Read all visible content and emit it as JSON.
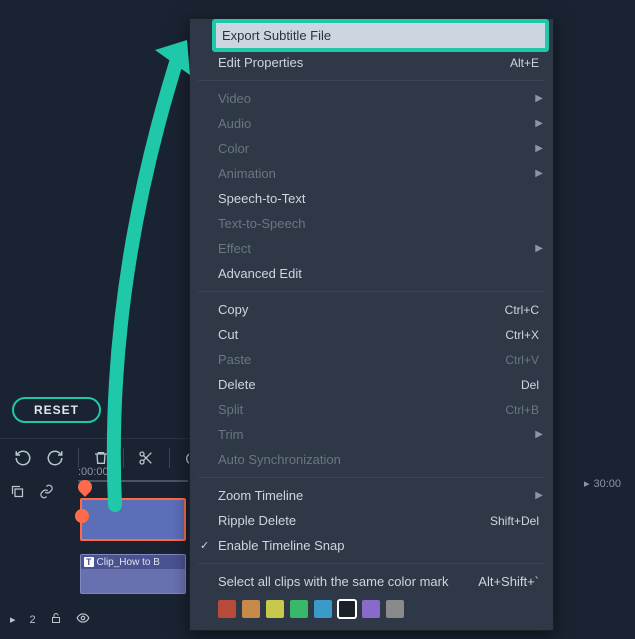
{
  "reset_label": "RESET",
  "timeline": {
    "start_time": ":00:00",
    "right_time": "30:00",
    "clip_label": "Clip_How to B"
  },
  "context_menu": {
    "items": [
      {
        "label": "Export Subtitle File",
        "highlighted": true
      },
      {
        "label": "Edit Properties",
        "shortcut": "Alt+E"
      },
      {
        "sep": true
      },
      {
        "label": "Video",
        "disabled": true,
        "submenu": true
      },
      {
        "label": "Audio",
        "disabled": true,
        "submenu": true
      },
      {
        "label": "Color",
        "disabled": true,
        "submenu": true
      },
      {
        "label": "Animation",
        "disabled": true,
        "submenu": true
      },
      {
        "label": "Speech-to-Text"
      },
      {
        "label": "Text-to-Speech",
        "disabled": true
      },
      {
        "label": "Effect",
        "disabled": true,
        "submenu": true
      },
      {
        "label": "Advanced Edit"
      },
      {
        "sep": true
      },
      {
        "label": "Copy",
        "shortcut": "Ctrl+C"
      },
      {
        "label": "Cut",
        "shortcut": "Ctrl+X"
      },
      {
        "label": "Paste",
        "disabled": true,
        "shortcut": "Ctrl+V"
      },
      {
        "label": "Delete",
        "shortcut": "Del"
      },
      {
        "label": "Split",
        "disabled": true,
        "shortcut": "Ctrl+B"
      },
      {
        "label": "Trim",
        "disabled": true,
        "submenu": true
      },
      {
        "label": "Auto Synchronization",
        "disabled": true
      },
      {
        "sep": true
      },
      {
        "label": "Zoom Timeline",
        "submenu": true
      },
      {
        "label": "Ripple Delete",
        "shortcut": "Shift+Del"
      },
      {
        "label": "Enable Timeline Snap",
        "checked": true
      },
      {
        "sep": true
      }
    ],
    "color_mark_label": "Select all clips with the same color mark",
    "color_mark_shortcut": "Alt+Shift+`",
    "colors": [
      "#b84a3a",
      "#c88a4a",
      "#c8c84a",
      "#3ab86a",
      "#3a9ac8",
      "#ffffff",
      "#8a6ac8",
      "#8a8a8a"
    ],
    "selected_color_index": 5
  }
}
